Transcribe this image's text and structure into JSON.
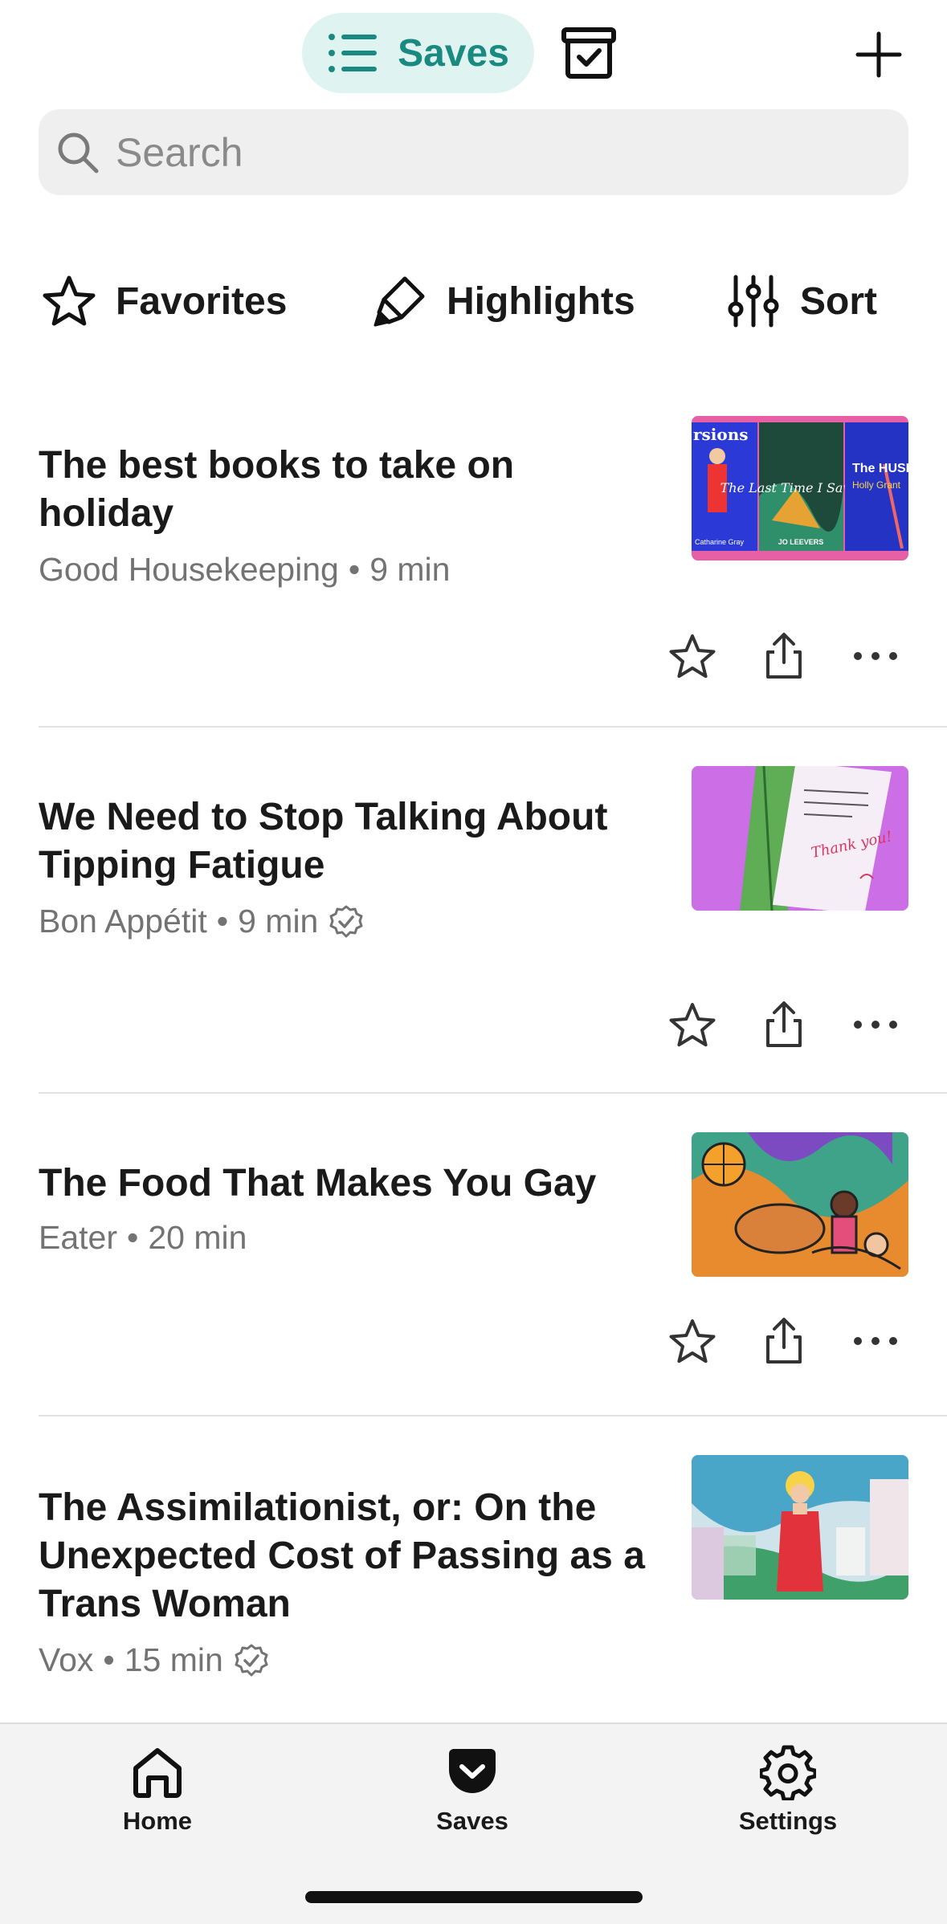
{
  "header": {
    "saves_label": "Saves"
  },
  "search": {
    "placeholder": "Search"
  },
  "filters": {
    "favorites": "Favorites",
    "highlights": "Highlights",
    "sort": "Sort"
  },
  "articles": [
    {
      "title": "The best books to take on holiday",
      "source": "Good Housekeeping",
      "sep": "•",
      "time": "9 min",
      "verified": false
    },
    {
      "title": "We Need to Stop Talking About Tipping Fatigue",
      "source": "Bon Appétit",
      "sep": "•",
      "time": "9 min",
      "verified": true
    },
    {
      "title": "The Food That Makes You Gay",
      "source": "Eater",
      "sep": "•",
      "time": "20 min",
      "verified": false
    },
    {
      "title": "The Assimilationist, or: On the Unexpected Cost of Passing as a Trans Woman",
      "source": "Vox",
      "sep": "•",
      "time": "15 min",
      "verified": true
    }
  ],
  "thumb_text": {
    "a1_left": "rsions",
    "a1_mid": "The Last Time I Saw You",
    "a1_mid_author": "JO LEEVERS",
    "a1_right": "The HUSBAN",
    "a1_right_author": "Holly Grant",
    "a1_left_author": "Catharine Gray",
    "a2_note": "Thank you!"
  },
  "nav": {
    "home": "Home",
    "saves": "Saves",
    "settings": "Settings"
  },
  "colors": {
    "accent": "#1a8a80",
    "pill_bg": "#dff3f1"
  }
}
